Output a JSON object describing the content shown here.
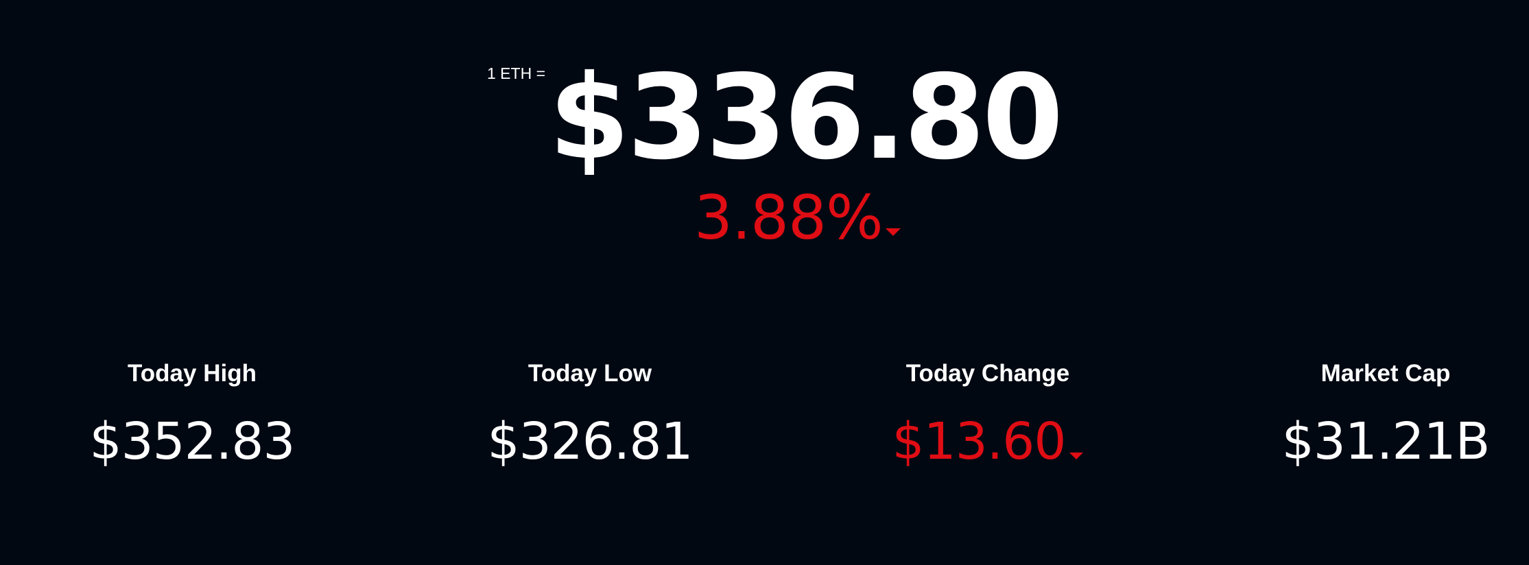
{
  "ticker": {
    "unit_label": "1 ETH =",
    "price": "$336.80",
    "percent_change": "3.88%",
    "direction": "down",
    "down_color": "#e00d14",
    "caret_icon": "caret-down-icon"
  },
  "stats": [
    {
      "label": "Today High",
      "value": "$352.83"
    },
    {
      "label": "Today Low",
      "value": "$326.81"
    },
    {
      "label": "Today Change",
      "value": "$13.60",
      "direction": "down"
    },
    {
      "label": "Market Cap",
      "value": "$31.21B"
    }
  ],
  "colors": {
    "background": "#020812",
    "text": "#ffffff",
    "negative": "#e00d14"
  }
}
